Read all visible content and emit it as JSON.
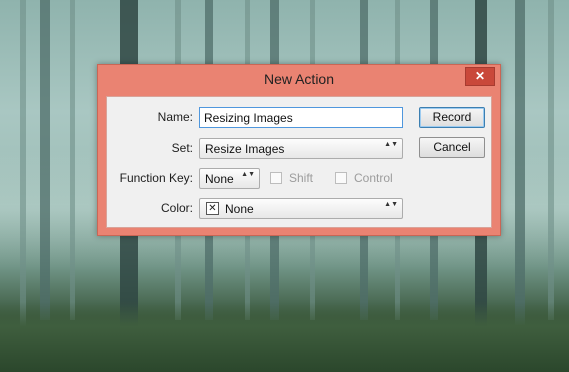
{
  "dialog": {
    "title": "New Action",
    "close_glyph": "✕",
    "fields": {
      "name_label": "Name:",
      "name_value": "Resizing Images",
      "set_label": "Set:",
      "set_value": "Resize Images",
      "function_key_label": "Function Key:",
      "function_key_value": "None",
      "shift_label": "Shift",
      "shift_checked": false,
      "control_label": "Control",
      "control_checked": false,
      "color_label": "Color:",
      "color_value": "None",
      "color_swatch_glyph": "✕"
    },
    "buttons": {
      "record_label": "Record",
      "cancel_label": "Cancel"
    },
    "select_arrows": "▲▼"
  },
  "colors": {
    "titlebar": "#ea8372",
    "close_button": "#c9483a",
    "content_bg": "#f0f0f0",
    "focus_border": "#4f97dd"
  }
}
